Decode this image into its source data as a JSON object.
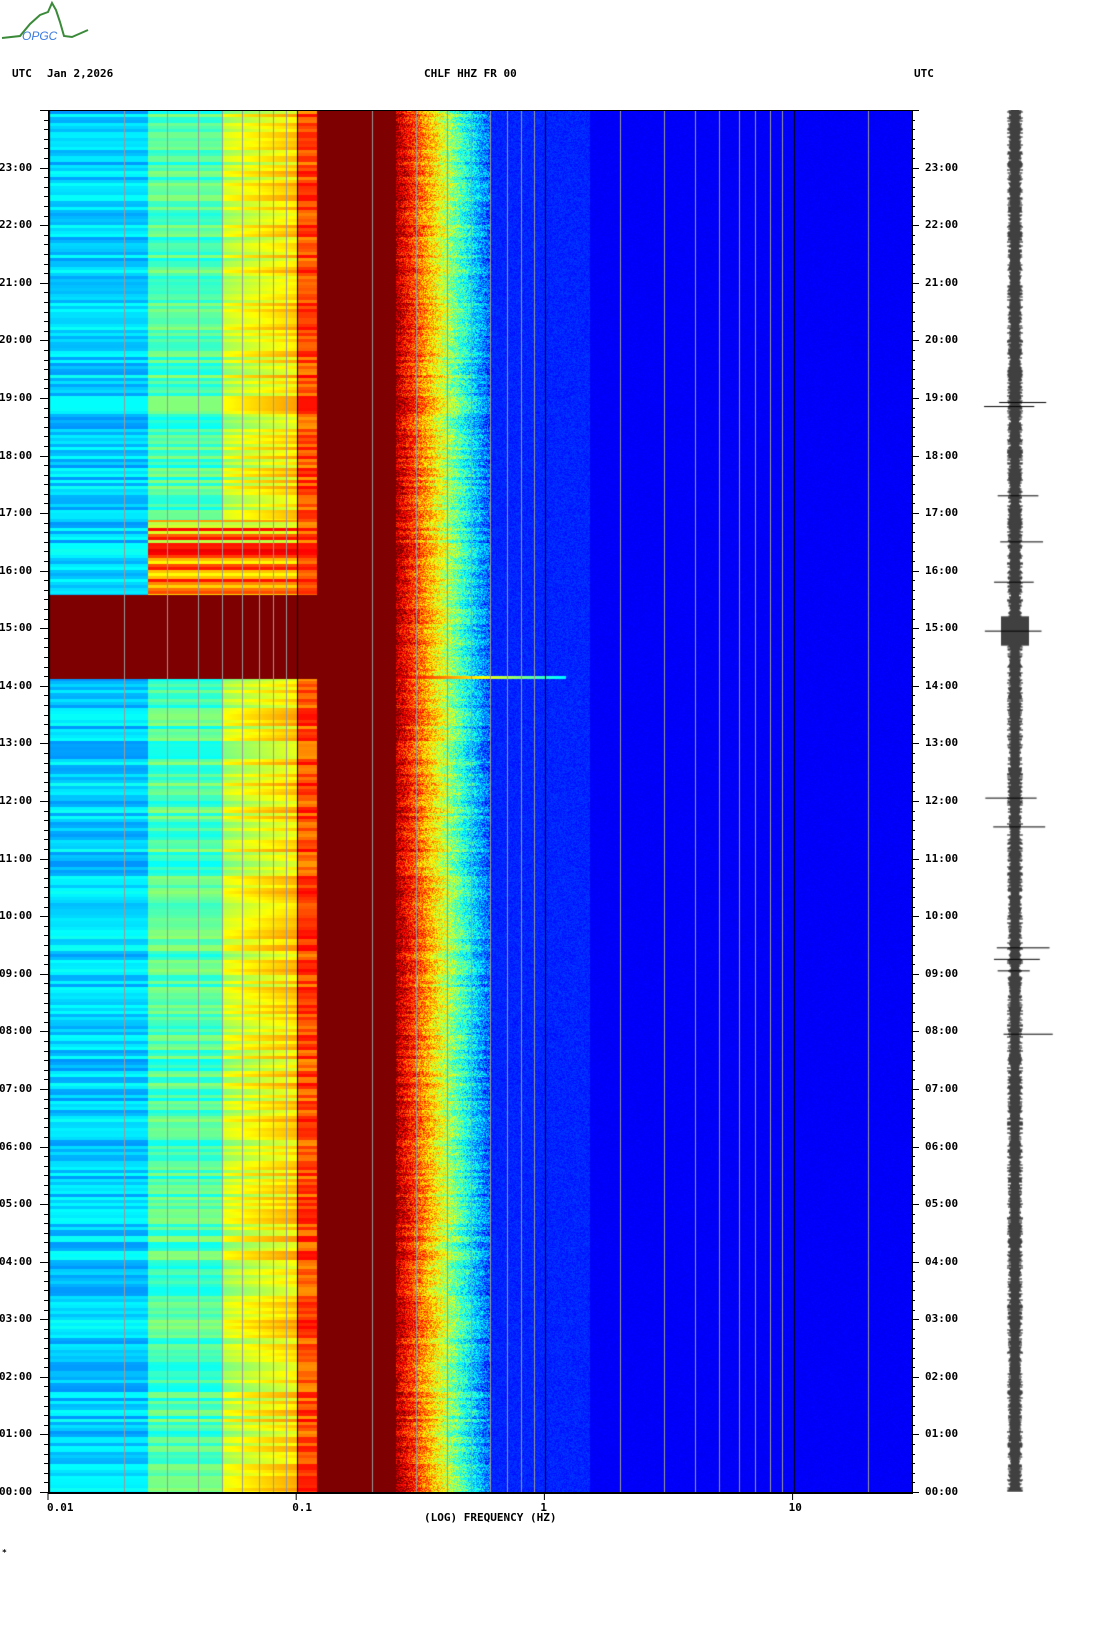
{
  "header": {
    "left_tz": "UTC",
    "date": "Jan 2,2026",
    "station": "CHLF HHZ FR 00",
    "right_tz": "UTC"
  },
  "logo": {
    "text": "OPGC"
  },
  "chart_data": {
    "type": "heatmap",
    "title": "CHLF HHZ FR 00",
    "xlabel": "(LOG) FREQUENCY (HZ)",
    "xscale": "log",
    "xlim": [
      0.01,
      30
    ],
    "x_tick_labels": [
      "0.01",
      "0.1",
      "1",
      "10"
    ],
    "x_ticks": [
      0.01,
      0.1,
      1,
      10
    ],
    "ylabel": "UTC",
    "ylim_hours": [
      0,
      24
    ],
    "y_tick_labels": [
      "00:00",
      "01:00",
      "02:00",
      "03:00",
      "04:00",
      "05:00",
      "06:00",
      "07:00",
      "08:00",
      "09:00",
      "10:00",
      "11:00",
      "12:00",
      "13:00",
      "14:00",
      "15:00",
      "16:00",
      "17:00",
      "18:00",
      "19:00",
      "20:00",
      "21:00",
      "22:00",
      "23:00"
    ],
    "colormap": "jet",
    "features": [
      {
        "name": "microseism peak",
        "freq_hz": [
          0.12,
          0.25
        ],
        "hours": [
          0,
          24
        ],
        "level": "max"
      },
      {
        "name": "event",
        "freq_hz": [
          0.01,
          0.12
        ],
        "hours": [
          14.15,
          15.6
        ],
        "level": "max"
      },
      {
        "name": "event coda",
        "freq_hz": [
          0.025,
          0.1
        ],
        "hours": [
          15.6,
          16.9
        ],
        "level": "high"
      },
      {
        "name": "transient",
        "freq_hz": [
          0.25,
          1.2
        ],
        "hours": [
          14.15,
          14.2
        ],
        "level": "high"
      }
    ],
    "trace_spikes_hours": [
      18.85,
      18.92,
      17.3,
      16.5,
      15.8,
      14.95,
      12.05,
      11.55,
      9.45,
      9.25,
      9.05,
      7.95
    ]
  },
  "footer": {
    "mark": "*"
  }
}
